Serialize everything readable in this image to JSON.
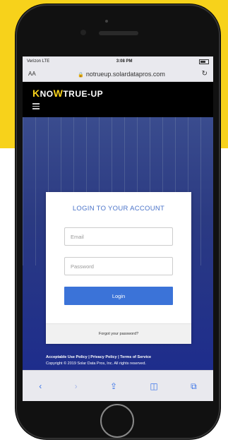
{
  "status_bar": {
    "carrier": "Verizon LTE",
    "time": "3:08 PM"
  },
  "url_bar": {
    "aa_label": "AA",
    "url": "notrueup.solardatapros.com"
  },
  "site": {
    "logo_k": "K",
    "logo_now": "NO",
    "logo_w": "W",
    "logo_rest": "TRUE-UP",
    "card_title": "LOGIN TO YOUR ACCOUNT",
    "email_placeholder": "Email",
    "password_placeholder": "Password",
    "login_label": "Login",
    "forgot_label": "Forgot your password?",
    "legal_links": "Acceptable Use Policy | Privacy Policy | Terms of Service",
    "copyright": "Copyright © 2019 Solar Data Pros, Inc. All rights reserved."
  },
  "colors": {
    "accent_yellow": "#f7d21b",
    "brand_blue": "#3b73d8"
  }
}
